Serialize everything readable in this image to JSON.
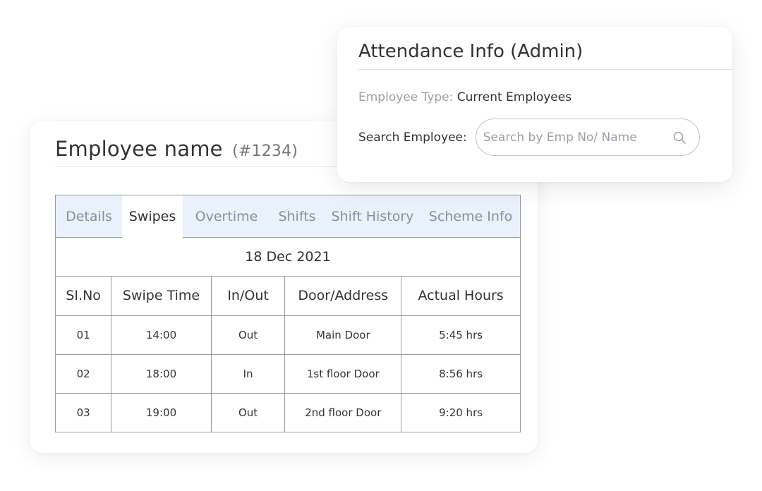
{
  "employee": {
    "name": "Employee name",
    "id": "(#1234)",
    "tabs": [
      {
        "label": "Details",
        "active": false
      },
      {
        "label": "Swipes",
        "active": true
      },
      {
        "label": "Overtime",
        "active": false
      },
      {
        "label": "Shifts",
        "active": false
      },
      {
        "label": "Shift History",
        "active": false
      },
      {
        "label": "Scheme Info",
        "active": false
      }
    ],
    "date": "18 Dec 2021",
    "columns": [
      "SI.No",
      "Swipe Time",
      "In/Out",
      "Door/Address",
      "Actual Hours"
    ],
    "rows": [
      [
        "01",
        "14:00",
        "Out",
        "Main Door",
        "5:45 hrs"
      ],
      [
        "02",
        "18:00",
        "In",
        "1st floor Door",
        "8:56 hrs"
      ],
      [
        "03",
        "19:00",
        "Out",
        "2nd floor Door",
        "9:20 hrs"
      ]
    ]
  },
  "attendance": {
    "title": "Attendance Info (Admin)",
    "employee_type_label": "Employee Type:",
    "employee_type_value": "Current Employees",
    "search_label": "Search Employee:",
    "search_placeholder": "Search by Emp No/ Name",
    "search_value": "",
    "search_icon": "search-icon"
  },
  "colors": {
    "tab_bar_bg": "#e9f2fc",
    "border": "#9a9a9a",
    "muted_text": "#9a9ea8"
  }
}
